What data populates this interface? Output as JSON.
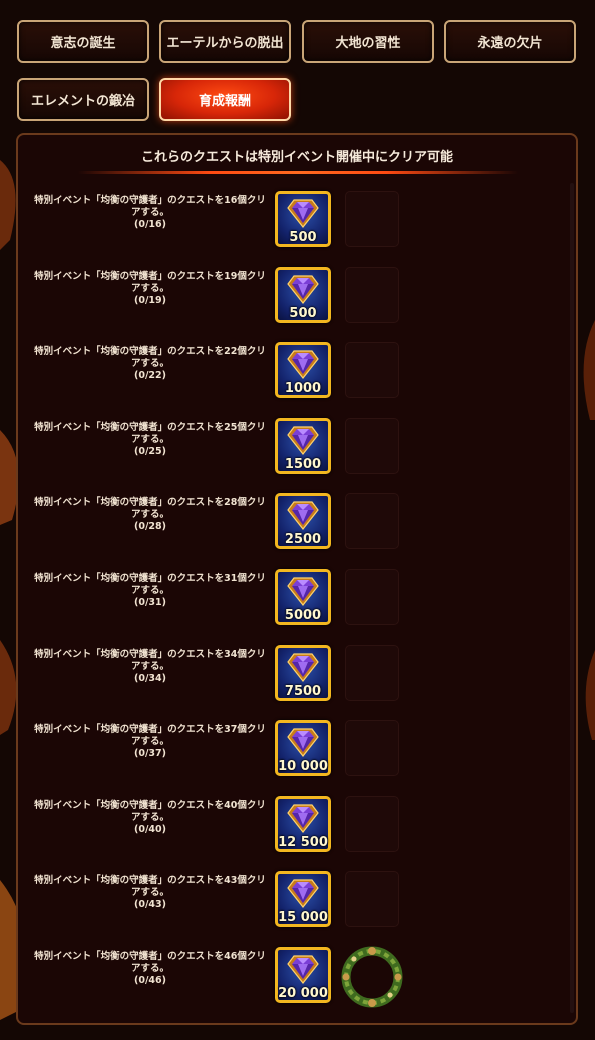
{
  "tabs": [
    {
      "label": "意志の誕生",
      "active": false
    },
    {
      "label": "エーテルからの脱出",
      "active": false
    },
    {
      "label": "大地の習性",
      "active": false
    },
    {
      "label": "永遠の欠片",
      "active": false
    },
    {
      "label": "エレメントの鍛冶",
      "active": false
    },
    {
      "label": "育成報酬",
      "active": true
    }
  ],
  "panel": {
    "header": "これらのクエストは特別イベント開催中にクリア可能"
  },
  "quests": [
    {
      "text": "特別イベント「均衡の守護者」のクエストを16個クリアする。",
      "progress": "(0/16)",
      "reward": "500",
      "extra": "empty-slot"
    },
    {
      "text": "特別イベント「均衡の守護者」のクエストを19個クリアする。",
      "progress": "(0/19)",
      "reward": "500",
      "extra": "empty-slot"
    },
    {
      "text": "特別イベント「均衡の守護者」のクエストを22個クリアする。",
      "progress": "(0/22)",
      "reward": "1000",
      "extra": "empty-slot"
    },
    {
      "text": "特別イベント「均衡の守護者」のクエストを25個クリアする。",
      "progress": "(0/25)",
      "reward": "1500",
      "extra": "empty-slot"
    },
    {
      "text": "特別イベント「均衡の守護者」のクエストを28個クリアする。",
      "progress": "(0/28)",
      "reward": "2500",
      "extra": "empty-slot"
    },
    {
      "text": "特別イベント「均衡の守護者」のクエストを31個クリアする。",
      "progress": "(0/31)",
      "reward": "5000",
      "extra": "empty-slot"
    },
    {
      "text": "特別イベント「均衡の守護者」のクエストを34個クリアする。",
      "progress": "(0/34)",
      "reward": "7500",
      "extra": "empty-slot"
    },
    {
      "text": "特別イベント「均衡の守護者」のクエストを37個クリアする。",
      "progress": "(0/37)",
      "reward": "10 000",
      "extra": "empty-slot"
    },
    {
      "text": "特別イベント「均衡の守護者」のクエストを40個クリアする。",
      "progress": "(0/40)",
      "reward": "12 500",
      "extra": "empty-slot"
    },
    {
      "text": "特別イベント「均衡の守護者」のクエストを43個クリアする。",
      "progress": "(0/43)",
      "reward": "15 000",
      "extra": "empty-slot"
    },
    {
      "text": "特別イベント「均衡の守護者」のクエストを46個クリアする。",
      "progress": "(0/46)",
      "reward": "20 000",
      "extra": "wreath-frame-icon"
    }
  ],
  "icons": {
    "reward": "gem-chest-icon"
  },
  "colors": {
    "background": "#140704",
    "active_tab": "#e0300c",
    "reward_border": "#f3b720",
    "panel_border": "#6b3a1c"
  }
}
